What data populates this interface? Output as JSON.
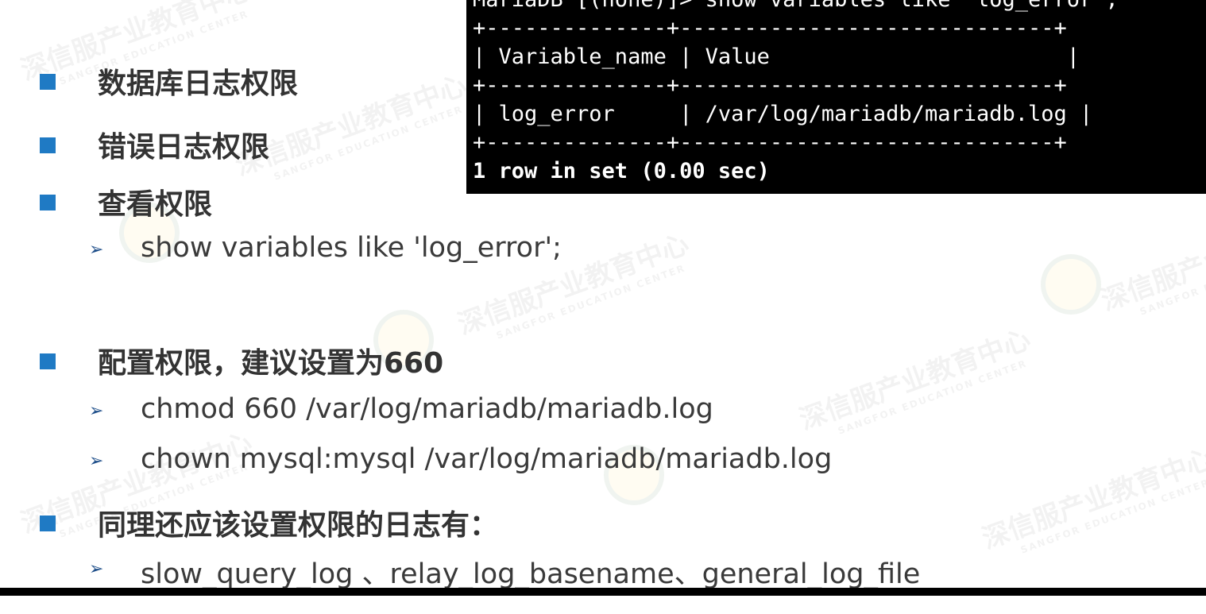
{
  "terminal": {
    "lines": [
      "MariaDB [(none)]> show variables like 'log_error';",
      "+--------------+-----------------------------+",
      "| Variable_name | Value                       |",
      "+--------------+-----------------------------+",
      "| log_error     | /var/log/mariadb/mariadb.log |",
      "+--------------+-----------------------------+",
      "1 row in set (0.00 sec)"
    ]
  },
  "bullets": {
    "db_log_perm": "数据库日志权限",
    "error_log_perm": "错误日志权限",
    "view_perm": "查看权限",
    "view_cmd": "show variables like 'log_error';",
    "config_perm": "配置权限，建议设置为660",
    "chmod_cmd": "chmod 660 /var/log/mariadb/mariadb.log",
    "chown_cmd": "chown mysql:mysql /var/log/mariadb/mariadb.log",
    "similar_logs": "同理还应该设置权限的日志有：",
    "log_list": "slow_query_log 、relay_log_basename、general_log_file"
  },
  "watermark": {
    "text_cn": "深信服产业教育中心",
    "text_en": "SANGFOR EDUCATION CENTER"
  },
  "colors": {
    "bullet_square": "#1f7ac4",
    "arrow": "#1f4f8a",
    "terminal_bg": "#000000"
  },
  "icons": {
    "bullet": "square-bullet-icon",
    "sub_bullet": "arrow-bullet-icon"
  }
}
